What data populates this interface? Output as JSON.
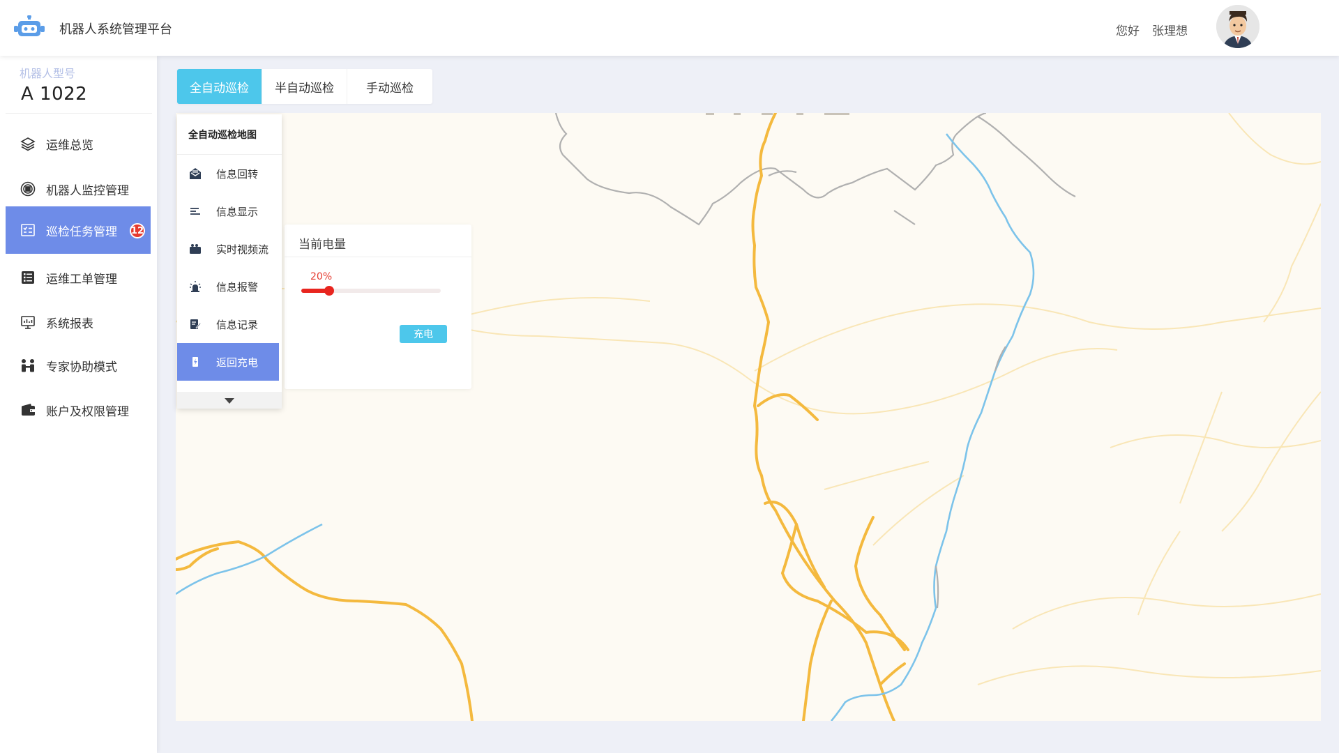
{
  "header": {
    "app_title": "机器人系统管理平台",
    "greeting": "您好",
    "username": "张理想"
  },
  "sidebar": {
    "model_label": "机器人型号",
    "model_value": "A 1022",
    "items": [
      {
        "label": "运维总览",
        "icon": "layers-icon"
      },
      {
        "label": "机器人监控管理",
        "icon": "monitor-circle-icon"
      },
      {
        "label": "巡检任务管理",
        "icon": "task-list-icon",
        "badge": "12",
        "active": true
      },
      {
        "label": "运维工单管理",
        "icon": "work-order-icon"
      },
      {
        "label": "系统报表",
        "icon": "report-icon"
      },
      {
        "label": "专家协助模式",
        "icon": "expert-icon"
      },
      {
        "label": "账户及权限管理",
        "icon": "wallet-icon"
      }
    ]
  },
  "tabs": [
    {
      "label": "全自动巡检",
      "active": true
    },
    {
      "label": "半自动巡检"
    },
    {
      "label": "手动巡检"
    }
  ],
  "map_menu": {
    "title": "全自动巡检地图",
    "items": [
      {
        "label": "信息回转",
        "icon": "envelope-open-icon"
      },
      {
        "label": "信息显示",
        "icon": "list-lines-icon"
      },
      {
        "label": "实时视频流",
        "icon": "video-camera-icon"
      },
      {
        "label": "信息报警",
        "icon": "alarm-light-icon"
      },
      {
        "label": "信息记录",
        "icon": "edit-note-icon"
      },
      {
        "label": "返回充电",
        "icon": "battery-charge-icon",
        "active": true
      }
    ]
  },
  "battery": {
    "title": "当前电量",
    "percent_label": "20%",
    "level": 0.2,
    "button": "充电"
  },
  "colors": {
    "accent_blue": "#4dc7eb",
    "active_nav": "#6e8ce8",
    "badge_red": "#e53a2f",
    "road_orange": "#f4b93e",
    "river_blue": "#7cc3ea"
  }
}
